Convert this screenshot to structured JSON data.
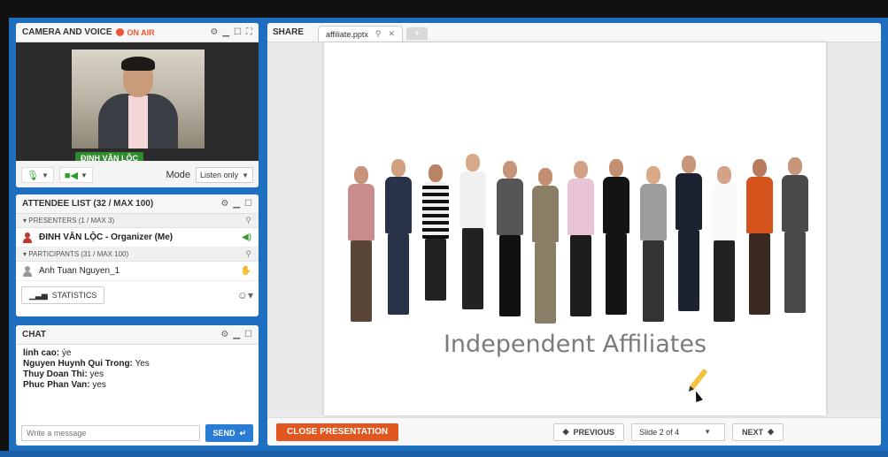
{
  "camera": {
    "title": "CAMERA AND VOICE",
    "status": "ON AIR",
    "presenter_name": "ĐINH VĂN LỘC",
    "mode_label": "Mode",
    "mode_value": "Listen only"
  },
  "attendees": {
    "title": "ATTENDEE LIST  (32 / MAX 100)",
    "presenters_label": "PRESENTERS (1 / MAX 3)",
    "presenter": "ĐINH VĂN LỘC - Organizer (Me)",
    "participants_label": "PARTICIPANTS (31 / MAX 100)",
    "participant": "Anh Tuan Nguyen_1",
    "statistics_label": "STATISTICS"
  },
  "chat": {
    "title": "CHAT",
    "messages": [
      {
        "author": "linh cao:",
        "text": " ýe"
      },
      {
        "author": "Nguyen Huynh Qui Trong:",
        "text": " Yes"
      },
      {
        "author": "Thuy Doan Thi:",
        "text": " yes"
      },
      {
        "author": "Phuc Phan Van:",
        "text": " yes"
      }
    ],
    "input_placeholder": "Write a message",
    "send_label": "SEND"
  },
  "share": {
    "label": "SHARE",
    "tab_name": "affiliate.pptx",
    "slide_title": "Independent Affiliates",
    "close_label": "CLOSE PRESENTATION",
    "previous_label": "PREVIOUS",
    "slide_indicator": "Slide 2 of 4",
    "next_label": "NEXT"
  },
  "colors": {
    "frame": "#1f6fc0",
    "on_air": "#e53333",
    "close_button": "#e2561f",
    "send_button": "#2a7bd4",
    "badge": "#2e8b2e"
  }
}
